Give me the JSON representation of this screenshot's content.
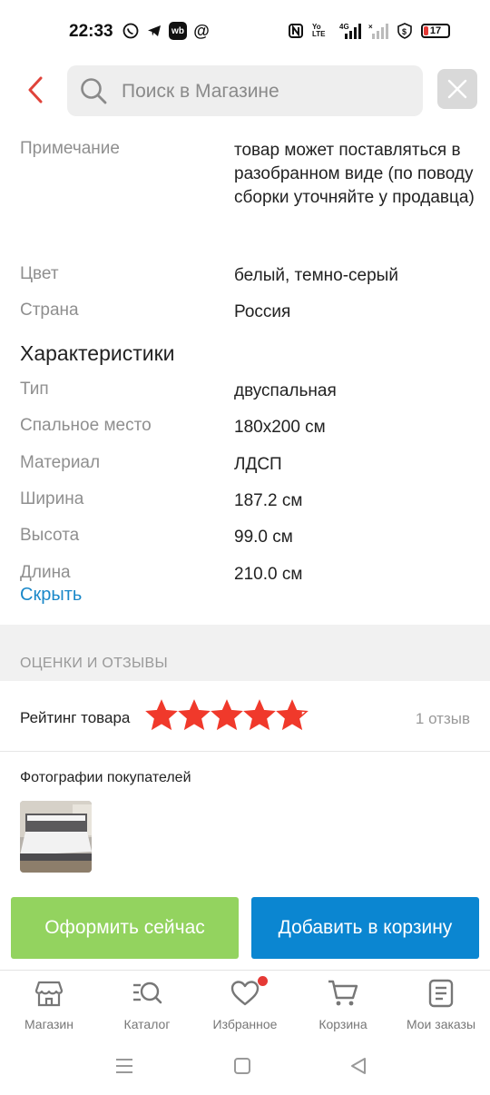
{
  "status_bar": {
    "time": "22:33",
    "left_icons": [
      "whatsapp-icon",
      "telegram-icon",
      "wb-icon",
      "at-icon"
    ],
    "wb_text": "wb",
    "right_icons": [
      "nfc-icon",
      "volte-icon",
      "signal-4g-icon",
      "signal-no-service-icon",
      "shield-icon"
    ],
    "volte_text": "Yo LTE",
    "net_text": "4G",
    "battery_level": "17"
  },
  "header": {
    "search_placeholder": "Поиск в Магазине"
  },
  "specs_top": [
    {
      "label": "Примечание",
      "value": "товар может поставляться в разобранном виде (по поводу сборки уточняйте у продавца)"
    },
    {
      "label": "Цвет",
      "value": "белый, темно-серый"
    },
    {
      "label": "Страна",
      "value": "Россия"
    }
  ],
  "characteristics": {
    "title": "Характеристики",
    "rows": [
      {
        "label": "Тип",
        "value": "двуспальная"
      },
      {
        "label": "Спальное место",
        "value": "180x200 см"
      },
      {
        "label": "Материал",
        "value": "ЛДСП"
      },
      {
        "label": "Ширина",
        "value": "187.2 см"
      },
      {
        "label": "Высота",
        "value": "99.0 см"
      },
      {
        "label": "Длина",
        "value": "210.0 см"
      }
    ],
    "hide_label": "Скрыть"
  },
  "reviews": {
    "header": "ОЦЕНКИ И ОТЗЫВЫ",
    "rating_label": "Рейтинг товара",
    "rating_stars": 4.8,
    "star_color": "#f0392b",
    "count": "1 отзыв",
    "photos_title": "Фотографии покупателей"
  },
  "actions": {
    "buy_now": "Оформить сейчас",
    "buy_color": "#93d35f",
    "add_to_cart": "Добавить в корзину",
    "cart_color": "#0b86d1"
  },
  "bottom_nav": [
    {
      "label": "Магазин",
      "icon": "store-icon"
    },
    {
      "label": "Каталог",
      "icon": "catalog-search-icon"
    },
    {
      "label": "Избранное",
      "icon": "heart-icon"
    },
    {
      "label": "Корзина",
      "icon": "cart-icon"
    },
    {
      "label": "Мои заказы",
      "icon": "orders-icon"
    }
  ]
}
